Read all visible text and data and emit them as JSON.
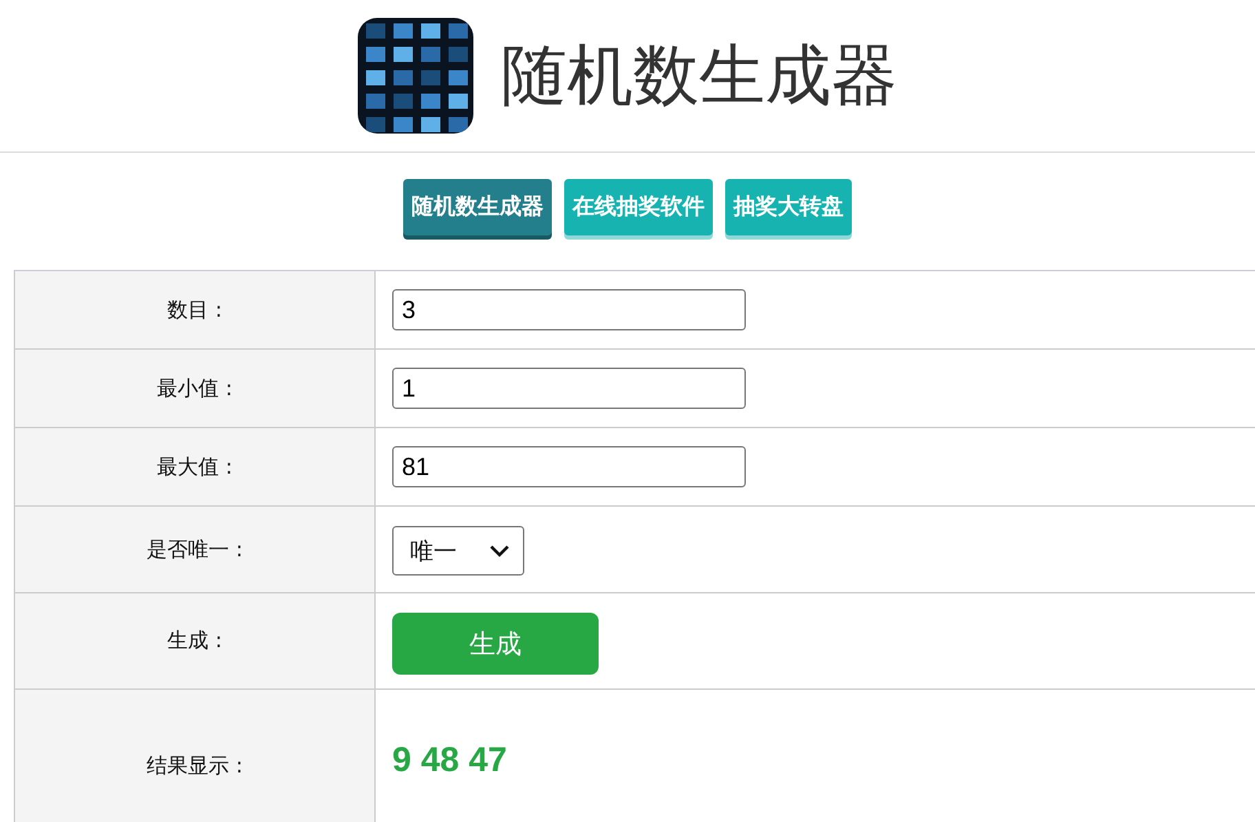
{
  "header": {
    "title": "随机数生成器"
  },
  "tabs": [
    {
      "label": "随机数生成器",
      "selected": true
    },
    {
      "label": "在线抽奖软件",
      "selected": false
    },
    {
      "label": "抽奖大转盘",
      "selected": false
    }
  ],
  "form": [
    {
      "kind": "input",
      "label": "数目 :",
      "value": "3"
    },
    {
      "kind": "input",
      "label": "最小值 :",
      "value": "1"
    },
    {
      "kind": "input",
      "label": "最大值 :",
      "value": "81"
    },
    {
      "kind": "select",
      "label": "是否唯一 :",
      "value": "唯一"
    },
    {
      "kind": "button",
      "label": "生成 :",
      "value": "生成"
    },
    {
      "kind": "result",
      "label": "结果显示 :",
      "value": "9 48 47"
    }
  ]
}
